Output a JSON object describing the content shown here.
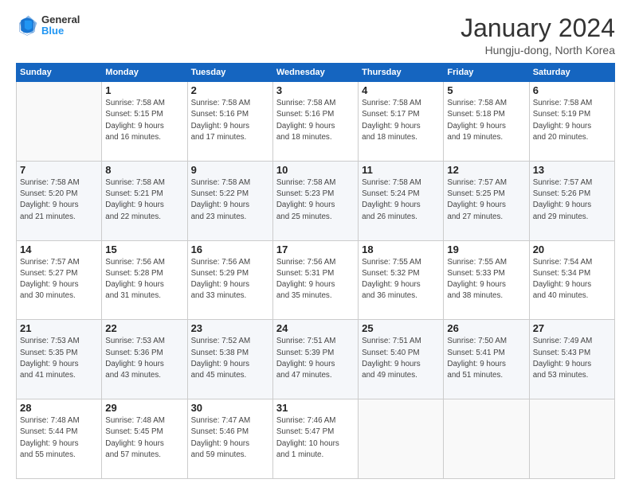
{
  "header": {
    "logo_general": "General",
    "logo_blue": "Blue",
    "month_title": "January 2024",
    "location": "Hungju-dong, North Korea"
  },
  "days_of_week": [
    "Sunday",
    "Monday",
    "Tuesday",
    "Wednesday",
    "Thursday",
    "Friday",
    "Saturday"
  ],
  "weeks": [
    [
      {
        "day": "",
        "info": ""
      },
      {
        "day": "1",
        "info": "Sunrise: 7:58 AM\nSunset: 5:15 PM\nDaylight: 9 hours\nand 16 minutes."
      },
      {
        "day": "2",
        "info": "Sunrise: 7:58 AM\nSunset: 5:16 PM\nDaylight: 9 hours\nand 17 minutes."
      },
      {
        "day": "3",
        "info": "Sunrise: 7:58 AM\nSunset: 5:16 PM\nDaylight: 9 hours\nand 18 minutes."
      },
      {
        "day": "4",
        "info": "Sunrise: 7:58 AM\nSunset: 5:17 PM\nDaylight: 9 hours\nand 18 minutes."
      },
      {
        "day": "5",
        "info": "Sunrise: 7:58 AM\nSunset: 5:18 PM\nDaylight: 9 hours\nand 19 minutes."
      },
      {
        "day": "6",
        "info": "Sunrise: 7:58 AM\nSunset: 5:19 PM\nDaylight: 9 hours\nand 20 minutes."
      }
    ],
    [
      {
        "day": "7",
        "info": "Sunrise: 7:58 AM\nSunset: 5:20 PM\nDaylight: 9 hours\nand 21 minutes."
      },
      {
        "day": "8",
        "info": "Sunrise: 7:58 AM\nSunset: 5:21 PM\nDaylight: 9 hours\nand 22 minutes."
      },
      {
        "day": "9",
        "info": "Sunrise: 7:58 AM\nSunset: 5:22 PM\nDaylight: 9 hours\nand 23 minutes."
      },
      {
        "day": "10",
        "info": "Sunrise: 7:58 AM\nSunset: 5:23 PM\nDaylight: 9 hours\nand 25 minutes."
      },
      {
        "day": "11",
        "info": "Sunrise: 7:58 AM\nSunset: 5:24 PM\nDaylight: 9 hours\nand 26 minutes."
      },
      {
        "day": "12",
        "info": "Sunrise: 7:57 AM\nSunset: 5:25 PM\nDaylight: 9 hours\nand 27 minutes."
      },
      {
        "day": "13",
        "info": "Sunrise: 7:57 AM\nSunset: 5:26 PM\nDaylight: 9 hours\nand 29 minutes."
      }
    ],
    [
      {
        "day": "14",
        "info": "Sunrise: 7:57 AM\nSunset: 5:27 PM\nDaylight: 9 hours\nand 30 minutes."
      },
      {
        "day": "15",
        "info": "Sunrise: 7:56 AM\nSunset: 5:28 PM\nDaylight: 9 hours\nand 31 minutes."
      },
      {
        "day": "16",
        "info": "Sunrise: 7:56 AM\nSunset: 5:29 PM\nDaylight: 9 hours\nand 33 minutes."
      },
      {
        "day": "17",
        "info": "Sunrise: 7:56 AM\nSunset: 5:31 PM\nDaylight: 9 hours\nand 35 minutes."
      },
      {
        "day": "18",
        "info": "Sunrise: 7:55 AM\nSunset: 5:32 PM\nDaylight: 9 hours\nand 36 minutes."
      },
      {
        "day": "19",
        "info": "Sunrise: 7:55 AM\nSunset: 5:33 PM\nDaylight: 9 hours\nand 38 minutes."
      },
      {
        "day": "20",
        "info": "Sunrise: 7:54 AM\nSunset: 5:34 PM\nDaylight: 9 hours\nand 40 minutes."
      }
    ],
    [
      {
        "day": "21",
        "info": "Sunrise: 7:53 AM\nSunset: 5:35 PM\nDaylight: 9 hours\nand 41 minutes."
      },
      {
        "day": "22",
        "info": "Sunrise: 7:53 AM\nSunset: 5:36 PM\nDaylight: 9 hours\nand 43 minutes."
      },
      {
        "day": "23",
        "info": "Sunrise: 7:52 AM\nSunset: 5:38 PM\nDaylight: 9 hours\nand 45 minutes."
      },
      {
        "day": "24",
        "info": "Sunrise: 7:51 AM\nSunset: 5:39 PM\nDaylight: 9 hours\nand 47 minutes."
      },
      {
        "day": "25",
        "info": "Sunrise: 7:51 AM\nSunset: 5:40 PM\nDaylight: 9 hours\nand 49 minutes."
      },
      {
        "day": "26",
        "info": "Sunrise: 7:50 AM\nSunset: 5:41 PM\nDaylight: 9 hours\nand 51 minutes."
      },
      {
        "day": "27",
        "info": "Sunrise: 7:49 AM\nSunset: 5:43 PM\nDaylight: 9 hours\nand 53 minutes."
      }
    ],
    [
      {
        "day": "28",
        "info": "Sunrise: 7:48 AM\nSunset: 5:44 PM\nDaylight: 9 hours\nand 55 minutes."
      },
      {
        "day": "29",
        "info": "Sunrise: 7:48 AM\nSunset: 5:45 PM\nDaylight: 9 hours\nand 57 minutes."
      },
      {
        "day": "30",
        "info": "Sunrise: 7:47 AM\nSunset: 5:46 PM\nDaylight: 9 hours\nand 59 minutes."
      },
      {
        "day": "31",
        "info": "Sunrise: 7:46 AM\nSunset: 5:47 PM\nDaylight: 10 hours\nand 1 minute."
      },
      {
        "day": "",
        "info": ""
      },
      {
        "day": "",
        "info": ""
      },
      {
        "day": "",
        "info": ""
      }
    ]
  ]
}
